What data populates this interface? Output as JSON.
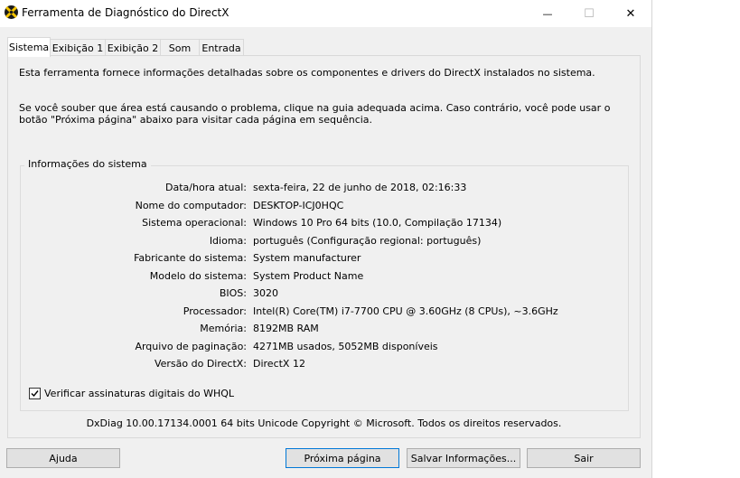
{
  "window": {
    "title": "Ferramenta de Diagnóstico do DirectX",
    "minimize_glyph": "—",
    "maximize_glyph": "☐",
    "close_glyph": "✕"
  },
  "tabs": [
    {
      "label": "Sistema",
      "active": true
    },
    {
      "label": "Exibição 1",
      "active": false
    },
    {
      "label": "Exibição 2",
      "active": false
    },
    {
      "label": "Som",
      "active": false
    },
    {
      "label": "Entrada",
      "active": false
    }
  ],
  "intro": {
    "line1": "Esta ferramenta fornece informações detalhadas sobre os componentes e drivers do DirectX instalados no sistema.",
    "line2": "Se você souber que área está causando o problema, clique na guia adequada acima. Caso contrário, você pode usar o botão \"Próxima página\" abaixo para visitar cada página em sequência."
  },
  "system_info": {
    "group_title": "Informações do sistema",
    "rows": [
      {
        "label": "Data/hora atual:",
        "value": "sexta-feira, 22 de junho de 2018, 02:16:33"
      },
      {
        "label": "Nome do computador:",
        "value": "DESKTOP-ICJ0HQC"
      },
      {
        "label": "Sistema operacional:",
        "value": "Windows 10 Pro 64 bits (10.0, Compilação 17134)"
      },
      {
        "label": "Idioma:",
        "value": "português (Configuração regional: português)"
      },
      {
        "label": "Fabricante do sistema:",
        "value": "System manufacturer"
      },
      {
        "label": "Modelo do sistema:",
        "value": "System Product Name"
      },
      {
        "label": "BIOS:",
        "value": "3020"
      },
      {
        "label": "Processador:",
        "value": "Intel(R) Core(TM) i7-7700 CPU @ 3.60GHz (8 CPUs), ~3.6GHz"
      },
      {
        "label": "Memória:",
        "value": "8192MB RAM"
      },
      {
        "label": "Arquivo de paginação:",
        "value": "4271MB usados, 5052MB disponíveis"
      },
      {
        "label": "Versão do DirectX:",
        "value": "DirectX 12"
      }
    ],
    "checkbox_label": "Verificar assinaturas digitais do WHQL",
    "checkbox_checked": true
  },
  "footer_note": "DxDiag 10.00.17134.0001 64 bits Unicode  Copyright © Microsoft. Todos os direitos reservados.",
  "buttons": {
    "help": "Ajuda",
    "next_page": "Próxima página",
    "save_info": "Salvar Informações...",
    "exit": "Sair"
  }
}
